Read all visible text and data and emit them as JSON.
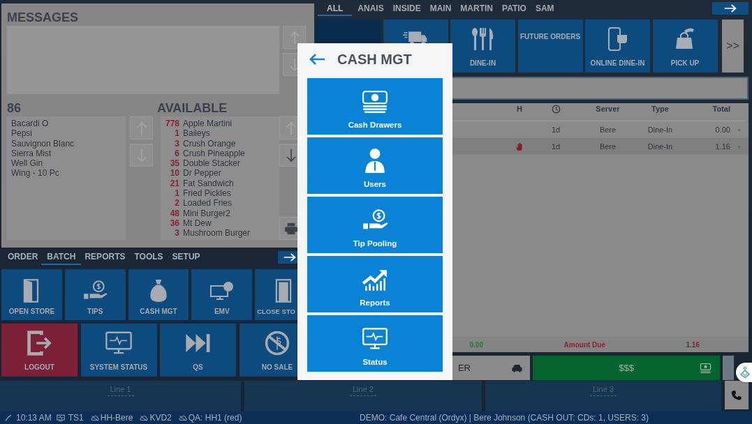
{
  "messages_panel": {
    "title": "MESSAGES",
    "scroll": [
      {
        "kind": "up",
        "disabled": true
      },
      {
        "kind": "down",
        "disabled": true
      }
    ]
  },
  "eighty_six": {
    "title": "86",
    "items": [
      "Bacardi O",
      "Pepsi",
      "Sauvignon Blanc",
      "Sierra Mist",
      "Well Gin",
      "Wing - 10 Pc"
    ],
    "scroll": [
      {
        "kind": "up",
        "disabled": true
      },
      {
        "kind": "down",
        "disabled": true
      }
    ]
  },
  "available": {
    "title": "AVAILABLE",
    "scroll": [
      {
        "kind": "up",
        "disabled": true
      },
      {
        "kind": "down",
        "disabled": false
      }
    ],
    "items": [
      {
        "count": "778",
        "name": "Apple Martini"
      },
      {
        "count": "1",
        "name": "Baileys"
      },
      {
        "count": "3",
        "name": "Crush Orange"
      },
      {
        "count": "6",
        "name": "Crush Pineapple"
      },
      {
        "count": "35",
        "name": "Double Stacker"
      },
      {
        "count": "10",
        "name": "Dr Pepper"
      },
      {
        "count": "21",
        "name": "Fat Sandwich"
      },
      {
        "count": "1",
        "name": "Fried Pickles"
      },
      {
        "count": "2",
        "name": "Loaded Fries"
      },
      {
        "count": "48",
        "name": "Mini Burger2"
      },
      {
        "count": "36",
        "name": "Mt Dew"
      },
      {
        "count": "3",
        "name": "Mushroom Burger"
      }
    ]
  },
  "function_tabs": [
    {
      "label": "ORDER",
      "selected": false
    },
    {
      "label": "BATCH",
      "selected": true
    },
    {
      "label": "REPORTS",
      "selected": false
    },
    {
      "label": "TOOLS",
      "selected": false
    },
    {
      "label": "SETUP",
      "selected": false
    }
  ],
  "function_tiles": [
    {
      "label": "OPEN STORE",
      "kind": "standard"
    },
    {
      "label": "TIPS",
      "kind": "standard"
    },
    {
      "label": "CASH MGT",
      "kind": "standard"
    },
    {
      "label": "EMV",
      "kind": "standard"
    },
    {
      "label": "CLOSE STO",
      "kind": "standard"
    }
  ],
  "function_tiles_2": [
    {
      "label": "LOGOUT",
      "kind": "alert"
    },
    {
      "label": "SYSTEM STATUS",
      "kind": "standard"
    },
    {
      "label": "QS",
      "kind": "standard"
    },
    {
      "label": "NO SALE",
      "kind": "standard"
    }
  ],
  "area_tabs": [
    {
      "label": "ALL",
      "selected": true
    },
    {
      "label": "ANAIS",
      "selected": false
    },
    {
      "label": "INSIDE",
      "selected": false
    },
    {
      "label": "MAIN",
      "selected": false
    },
    {
      "label": "MARTIN",
      "selected": false
    },
    {
      "label": "PATIO",
      "selected": false
    },
    {
      "label": "SAM",
      "selected": false
    }
  ],
  "order_type_tiles": [
    {
      "kind": "empty"
    },
    {
      "kind": "icon"
    },
    {
      "kind": "icon",
      "label": "DINE-IN"
    },
    {
      "kind": "text",
      "label": "FUTURE ORDERS"
    },
    {
      "kind": "icon",
      "label": "ONLINE DINE-IN"
    },
    {
      "kind": "icon",
      "label": "PICK UP"
    }
  ],
  "more_button": {
    "label": ">>"
  },
  "orders_table": {
    "columns": [
      {
        "kind": "text",
        "label": "H"
      },
      {
        "kind": "clock"
      },
      {
        "kind": "text",
        "label": "Server"
      },
      {
        "kind": "text",
        "label": "Type"
      },
      {
        "kind": "text",
        "label": "Total"
      }
    ],
    "rows": [
      {
        "held": false,
        "time": "1d",
        "server": "Bere",
        "type": "Dine-In",
        "total": "0.00"
      },
      {
        "held": true,
        "time": "1d",
        "server": "Bere",
        "type": "Dine-In",
        "total": "1.16"
      }
    ]
  },
  "totals": {
    "value": "0.00",
    "label": "Amount Due",
    "amount_due": "1.16"
  },
  "driver_button": {
    "label": "ER"
  },
  "pay_button": {
    "label": "$$$"
  },
  "lines": [
    {
      "label": "Line 1"
    },
    {
      "label": "Line 2"
    },
    {
      "label": "Line 3"
    }
  ],
  "status_bar": {
    "time": "10:13 AM",
    "terminal": "TS1",
    "devices": [
      "HH-Bere",
      "KVD2",
      "QA: HH1 (red)"
    ],
    "info": "DEMO: Cafe Central (Ordyx) | Bere Johnson (CASH OUT: CDs: 1, USERS: 3)"
  },
  "modal": {
    "title": "CASH MGT",
    "items": [
      {
        "label": "Cash Drawers"
      },
      {
        "label": "Users"
      },
      {
        "label": "Tip Pooling"
      },
      {
        "label": "Reports"
      },
      {
        "label": "Status"
      }
    ]
  }
}
